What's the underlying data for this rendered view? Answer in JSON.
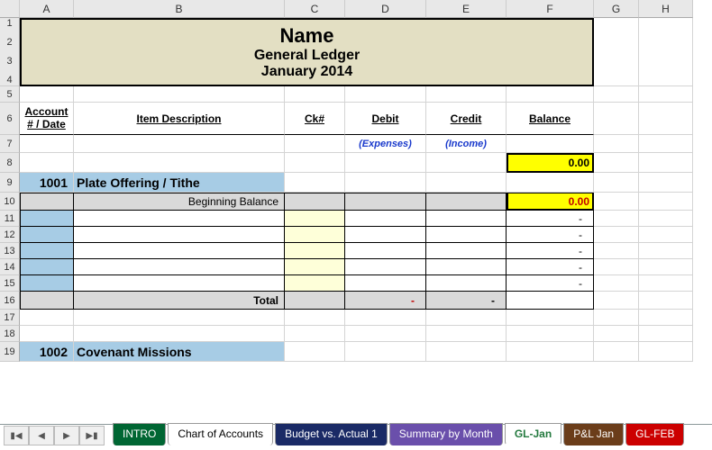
{
  "columns": [
    "",
    "A",
    "B",
    "C",
    "D",
    "E",
    "F",
    "G",
    "H"
  ],
  "rows": [
    "1",
    "2",
    "3",
    "4",
    "5",
    "6",
    "7",
    "8",
    "9",
    "10",
    "11",
    "12",
    "13",
    "14",
    "15",
    "16",
    "17",
    "18",
    "19"
  ],
  "title": {
    "name": "Name",
    "subtitle": "General Ledger",
    "period": "January 2014"
  },
  "headers": {
    "acct": "Account # / Date",
    "desc": "Item Description",
    "ck": "Ck#",
    "debit": "Debit",
    "credit": "Credit",
    "balance": "Balance",
    "expenses": "(Expenses)",
    "income": "(Income)"
  },
  "balance_initial": "0.00",
  "sections": [
    {
      "acct": "1001",
      "name": "Plate Offering / Tithe",
      "beginning_label": "Beginning Balance",
      "beginning_balance": "0.00",
      "rows": [
        {
          "debit": "",
          "credit": "",
          "balance": "-"
        },
        {
          "debit": "",
          "credit": "",
          "balance": "-"
        },
        {
          "debit": "",
          "credit": "",
          "balance": "-"
        },
        {
          "debit": "",
          "credit": "",
          "balance": "-"
        },
        {
          "debit": "",
          "credit": "",
          "balance": "-"
        }
      ],
      "total_label": "Total",
      "total_debit": "-",
      "total_credit": "-"
    },
    {
      "acct": "1002",
      "name": "Covenant Missions"
    }
  ],
  "tabs": [
    {
      "id": "intro",
      "label": "INTRO"
    },
    {
      "id": "coa",
      "label": "Chart of Accounts"
    },
    {
      "id": "budget",
      "label": "Budget vs. Actual 1"
    },
    {
      "id": "summary",
      "label": "Summary by Month"
    },
    {
      "id": "gljan",
      "label": "GL-Jan"
    },
    {
      "id": "pljan",
      "label": "P&L Jan"
    },
    {
      "id": "glfeb",
      "label": "GL-FEB"
    }
  ]
}
